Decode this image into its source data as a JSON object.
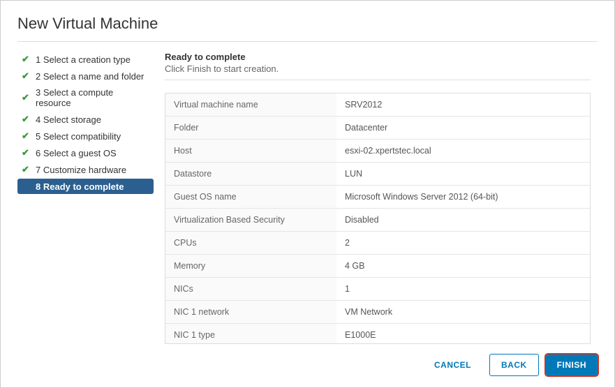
{
  "title": "New Virtual Machine",
  "sidebar": {
    "steps": [
      {
        "label": "1 Select a creation type",
        "active": false
      },
      {
        "label": "2 Select a name and folder",
        "active": false
      },
      {
        "label": "3 Select a compute resource",
        "active": false
      },
      {
        "label": "4 Select storage",
        "active": false
      },
      {
        "label": "5 Select compatibility",
        "active": false
      },
      {
        "label": "6 Select a guest OS",
        "active": false
      },
      {
        "label": "7 Customize hardware",
        "active": false
      },
      {
        "label": "8 Ready to complete",
        "active": true
      }
    ]
  },
  "content": {
    "heading": "Ready to complete",
    "subheading": "Click Finish to start creation."
  },
  "summary": [
    {
      "label": "Virtual machine name",
      "value": "SRV2012"
    },
    {
      "label": "Folder",
      "value": "Datacenter"
    },
    {
      "label": "Host",
      "value": "esxi-02.xpertstec.local"
    },
    {
      "label": "Datastore",
      "value": "LUN"
    },
    {
      "label": "Guest OS name",
      "value": "Microsoft Windows Server 2012 (64-bit)"
    },
    {
      "label": "Virtualization Based Security",
      "value": "Disabled"
    },
    {
      "label": "CPUs",
      "value": "2"
    },
    {
      "label": "Memory",
      "value": "4 GB"
    },
    {
      "label": "NICs",
      "value": "1"
    },
    {
      "label": "NIC 1 network",
      "value": "VM Network"
    },
    {
      "label": "NIC 1 type",
      "value": "E1000E"
    }
  ],
  "footer": {
    "cancel": "CANCEL",
    "back": "BACK",
    "finish": "FINISH"
  }
}
